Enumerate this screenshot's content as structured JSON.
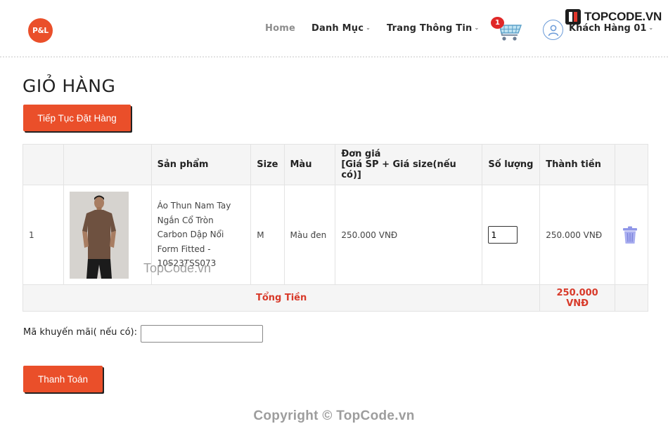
{
  "header": {
    "logo_text": "P&L",
    "nav": {
      "home": "Home",
      "categories": "Danh Mục",
      "info": "Trang Thông Tin"
    },
    "cart_count": "1",
    "user_name": "Khách Hàng 01",
    "watermark_brand": "TOPCODE.VN"
  },
  "page": {
    "title": "GIỎ HÀNG",
    "continue_button": "Tiếp Tục Đặt Hàng",
    "checkout_button": "Thanh Toán",
    "promo_label": "Mã khuyến mãi( nếu có):",
    "promo_value": ""
  },
  "table": {
    "headers": {
      "index": "",
      "image": "",
      "product": "Sản phẩm",
      "size": "Size",
      "color": "Màu",
      "unit_price_line1": "Đơn giá",
      "unit_price_line2": "[Giá SP + Giá size(nếu có)]",
      "quantity": "Số lượng",
      "subtotal": "Thành tiền",
      "action": ""
    },
    "rows": [
      {
        "index": "1",
        "product": "Áo Thun Nam Tay Ngắn Cổ Tròn Carbon Dập Nổi Form Fitted - 10S23TSS073",
        "size": "M",
        "color": "Màu đen",
        "unit_price": "250.000 VNĐ",
        "quantity": "1",
        "subtotal": "250.000 VNĐ"
      }
    ],
    "total_label": "Tổng Tiền",
    "total_value": "250.000 VNĐ"
  },
  "watermarks": {
    "center": "TopCode.vn",
    "copyright": "Copyright © TopCode.vn"
  },
  "colors": {
    "accent": "#ea4f2a",
    "total_text": "#d83a2a",
    "badge": "#e02828"
  }
}
